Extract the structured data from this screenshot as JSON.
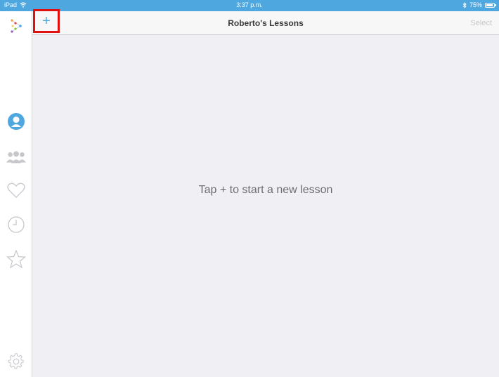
{
  "status_bar": {
    "device": "iPad",
    "time": "3:37 p.m.",
    "battery": "75%",
    "battery_level": 0.75
  },
  "nav": {
    "title": "Roberto's Lessons",
    "add_label": "+",
    "select_label": "Select"
  },
  "main": {
    "empty_message": "Tap + to start a new lesson"
  },
  "sidebar": {
    "items": [
      {
        "icon": "person-icon",
        "active": true
      },
      {
        "icon": "group-icon",
        "active": false
      },
      {
        "icon": "heart-icon",
        "active": false
      },
      {
        "icon": "clock-icon",
        "active": false
      },
      {
        "icon": "star-icon",
        "active": false
      },
      {
        "icon": "gear-icon",
        "active": false
      }
    ]
  },
  "colors": {
    "accent": "#4fa7e0",
    "highlight_box": "#e01010",
    "inactive_icon": "#c7c7cc"
  }
}
